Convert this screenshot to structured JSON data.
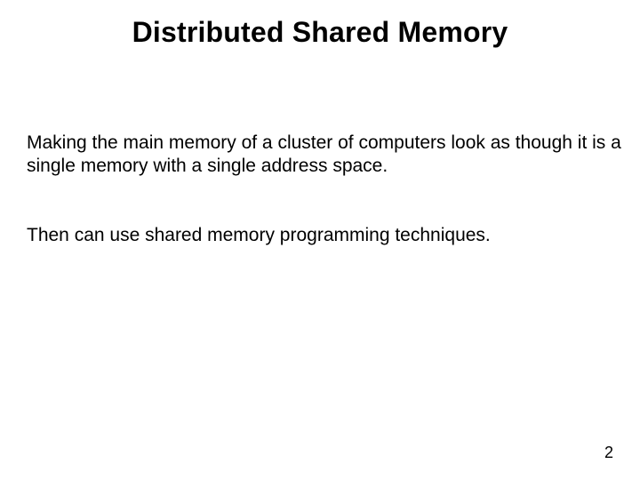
{
  "title": "Distributed Shared Memory",
  "paragraph1": "Making the main memory of a cluster of computers look as though it is a single memory with a single address space.",
  "paragraph2": "Then can use shared memory programming techniques.",
  "page_number": "2"
}
